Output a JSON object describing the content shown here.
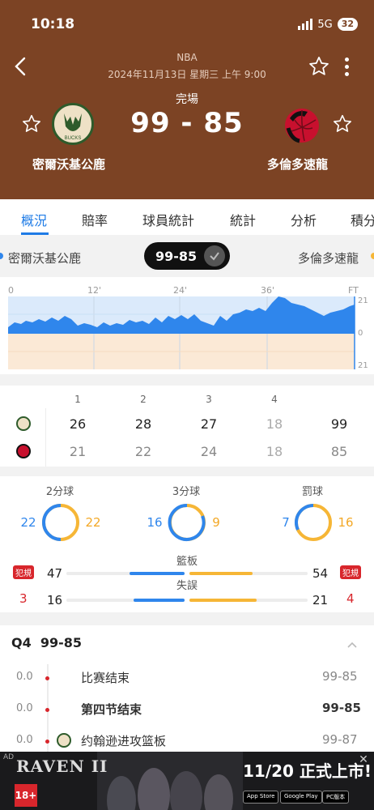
{
  "status_bar": {
    "time": "10:18",
    "network": "5G",
    "battery": "32"
  },
  "header": {
    "league": "NBA",
    "datetime": "2024年11月13日 星期三 上午 9:00",
    "state": "完場",
    "score": "99 - 85",
    "home_team": "密爾沃基公鹿",
    "away_team": "多倫多速龍",
    "home_logo_text": "BUCKS"
  },
  "tabs": [
    "概況",
    "賠率",
    "球員統計",
    "統計",
    "分析",
    "積分"
  ],
  "score_strip": {
    "home": "密爾沃基公鹿",
    "score": "99-85",
    "away": "多倫多速龍"
  },
  "momentum": {
    "x_ticks": [
      "0",
      "12'",
      "24'",
      "36'",
      "FT"
    ],
    "y_ticks": [
      "21",
      "0",
      "21"
    ],
    "colors": {
      "home": "#2f86ec",
      "away": "#f6c48e"
    }
  },
  "quarters": {
    "headers": [
      "1",
      "2",
      "3",
      "4"
    ],
    "home": [
      "26",
      "28",
      "27",
      "18",
      "99"
    ],
    "away": [
      "21",
      "22",
      "24",
      "18",
      "85"
    ]
  },
  "shooting": [
    {
      "label": "2分球",
      "home": "22",
      "away": "22"
    },
    {
      "label": "3分球",
      "home": "16",
      "away": "9"
    },
    {
      "label": "罰球",
      "home": "7",
      "away": "16"
    }
  ],
  "fouls": {
    "tag": "犯規",
    "home": "3",
    "away": "4"
  },
  "bars": [
    {
      "label": "籃板",
      "home": "47",
      "away": "54"
    },
    {
      "label": "失誤",
      "home": "16",
      "away": "21"
    }
  ],
  "events": {
    "quarter_label": "Q4",
    "quarter_score": "99-85",
    "items": [
      {
        "time": "0.0",
        "text": "比赛结束",
        "score": "99-85",
        "bold": false
      },
      {
        "time": "0.0",
        "text": "第四节结束",
        "score": "99-85",
        "bold": true
      },
      {
        "time": "0.0",
        "text": "约翰逊进攻篮板",
        "score": "99-87",
        "bold": false
      }
    ]
  },
  "ad": {
    "tag": "AD",
    "game": "RAVEN II",
    "rating": "18+",
    "headline": "11/20 正式上市!",
    "stores": [
      "App Store",
      "Google Play",
      "PC版本"
    ]
  }
}
